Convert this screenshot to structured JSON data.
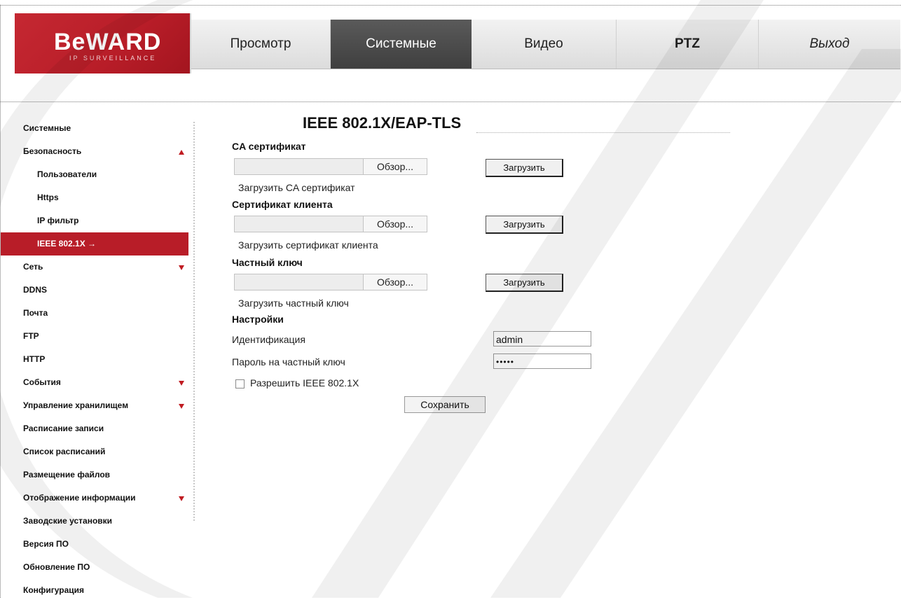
{
  "brand": {
    "name": "BeWARD",
    "tagline": "IP SURVEILLANCE"
  },
  "nav": [
    {
      "label": "Просмотр"
    },
    {
      "label": "Системные"
    },
    {
      "label": "Видео"
    },
    {
      "label": "PTZ"
    },
    {
      "label": "Выход"
    }
  ],
  "sidebar": {
    "items": [
      {
        "label": "Системные"
      },
      {
        "label": "Безопасность"
      },
      {
        "label": "Пользователи"
      },
      {
        "label": "Https"
      },
      {
        "label": "IP фильтр"
      },
      {
        "label": "IEEE 802.1X →"
      },
      {
        "label": "Сеть"
      },
      {
        "label": "DDNS"
      },
      {
        "label": "Почта"
      },
      {
        "label": "FTP"
      },
      {
        "label": "HTTP"
      },
      {
        "label": "События"
      },
      {
        "label": "Управление хранилищем"
      },
      {
        "label": "Расписание записи"
      },
      {
        "label": "Список расписаний"
      },
      {
        "label": "Размещение файлов"
      },
      {
        "label": "Отображение информации"
      },
      {
        "label": "Заводские установки"
      },
      {
        "label": "Версия ПО"
      },
      {
        "label": "Обновление ПО"
      },
      {
        "label": "Конфигурация"
      }
    ]
  },
  "main": {
    "title": "IEEE 802.1X/EAP-TLS",
    "ca": {
      "heading": "CA сертификат",
      "browse": "Обзор...",
      "upload": "Загрузить",
      "hint": "Загрузить CA сертификат"
    },
    "client": {
      "heading": "Сертификат клиента",
      "browse": "Обзор...",
      "upload": "Загрузить",
      "hint": "Загрузить сертификат клиента"
    },
    "key": {
      "heading": "Частный ключ",
      "browse": "Обзор...",
      "upload": "Загрузить",
      "hint": "Загрузить частный ключ"
    },
    "settings": {
      "heading": "Настройки",
      "identity_label": "Идентификация",
      "identity_value": "admin",
      "password_label": "Пароль на частный ключ",
      "password_value": "•••••",
      "enable_label": "Разрешить IEEE 802.1X",
      "enable_checked": false,
      "save": "Сохранить"
    }
  },
  "colors": {
    "brand_red": "#b81d28",
    "active_nav": "#4a4a4a"
  }
}
